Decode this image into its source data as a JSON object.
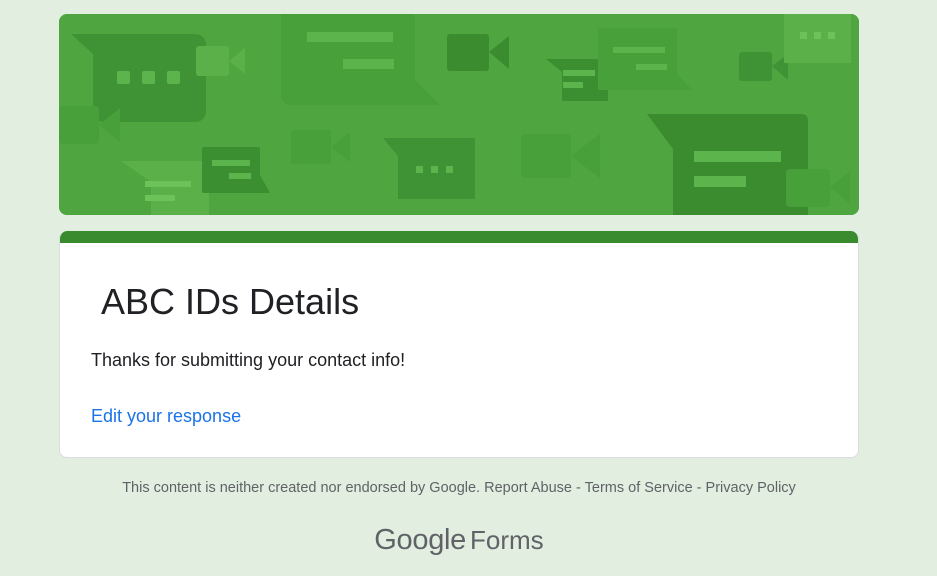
{
  "colors": {
    "page_background": "#e2eee0",
    "banner_green": "#4fa53f",
    "theme_accent": "#3a8a2e",
    "link_blue": "#1a73e8"
  },
  "header": {
    "banner_pattern": "chat-bubble-and-video-camera-icons"
  },
  "card": {
    "title": "ABC IDs Details",
    "message": "Thanks for submitting your contact info!",
    "edit_link": "Edit your response"
  },
  "footer": {
    "disclaimer": "This content is neither created nor endorsed by Google.",
    "report_abuse": "Report Abuse",
    "separator": "-",
    "terms": "Terms of Service",
    "privacy": "Privacy Policy",
    "brand_google": "Google",
    "brand_forms": "Forms"
  }
}
